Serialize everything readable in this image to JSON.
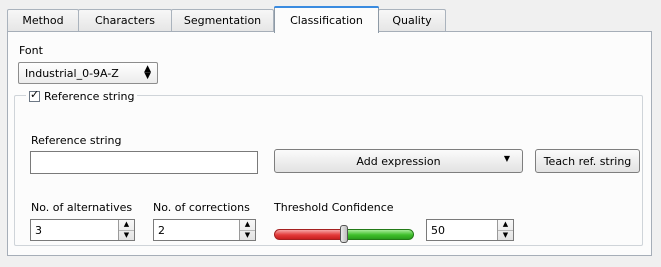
{
  "tabs": [
    {
      "label": "Method"
    },
    {
      "label": "Characters"
    },
    {
      "label": "Segmentation"
    },
    {
      "label": "Classification",
      "active": true
    },
    {
      "label": "Quality"
    }
  ],
  "font": {
    "label": "Font",
    "selected": "Industrial_0-9A-Z"
  },
  "reference_group": {
    "title": "Reference string",
    "checked": true,
    "field_label": "Reference string",
    "field_value": "",
    "add_expression_label": "Add expression",
    "teach_label": "Teach ref. string"
  },
  "alternatives": {
    "label": "No. of alternatives",
    "value": "3"
  },
  "corrections": {
    "label": "No. of corrections",
    "value": "2"
  },
  "threshold": {
    "label": "Threshold Confidence",
    "value": "50",
    "slider_fraction": 0.5
  },
  "colors": {
    "accent_tab": "#3a8be0",
    "slider_low": "#e33b3b",
    "slider_high": "#3fbf2b"
  }
}
